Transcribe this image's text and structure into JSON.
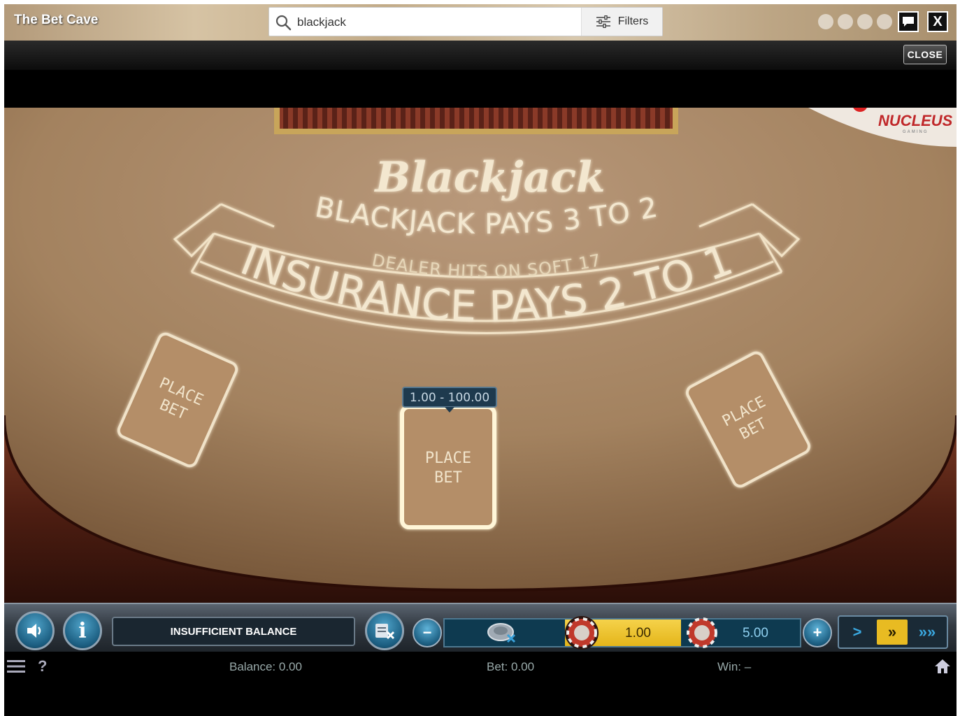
{
  "header": {
    "site_title": "The Bet Cave",
    "search": {
      "value": "blackjack",
      "placeholder": ""
    },
    "filters_label": "Filters",
    "close_x_label": "X"
  },
  "game_bar": {
    "close_label": "CLOSE"
  },
  "table": {
    "brand": "NUCLEUS",
    "brand_sub": "GAMING",
    "game_title": "Blackjack",
    "rule_1": "BLACKJACK PAYS 3 TO 2",
    "rule_2": "DEALER HITS ON SOFT 17",
    "rule_3": "INSURANCE PAYS 2 TO 1",
    "bet_limit": "1.00 - 100.00",
    "spots": [
      {
        "line1": "PLACE",
        "line2": "BET"
      },
      {
        "line1": "PLACE",
        "line2": "BET"
      },
      {
        "line1": "PLACE",
        "line2": "BET"
      }
    ]
  },
  "controls": {
    "message": "INSUFFICIENT BALANCE",
    "info_label": "i",
    "minus_label": "−",
    "plus_label": "+",
    "chips": [
      {
        "value": "",
        "color": "#9aa6b0"
      },
      {
        "value": "1.00",
        "color": "#c0392b",
        "selected": true
      },
      {
        "value": "5.00",
        "color": "#c0392b"
      }
    ],
    "speed_buttons": [
      ">",
      "»",
      "»»"
    ]
  },
  "info_bar": {
    "balance": "Balance: 0.00",
    "bet": "Bet: 0.00",
    "win": "Win: –",
    "help_label": "?"
  },
  "colors": {
    "felt": "#a8876a",
    "rail": "#5a2a1c",
    "chip_selected_bg": "#e8bb22",
    "panel_blue": "#0e3a50"
  }
}
